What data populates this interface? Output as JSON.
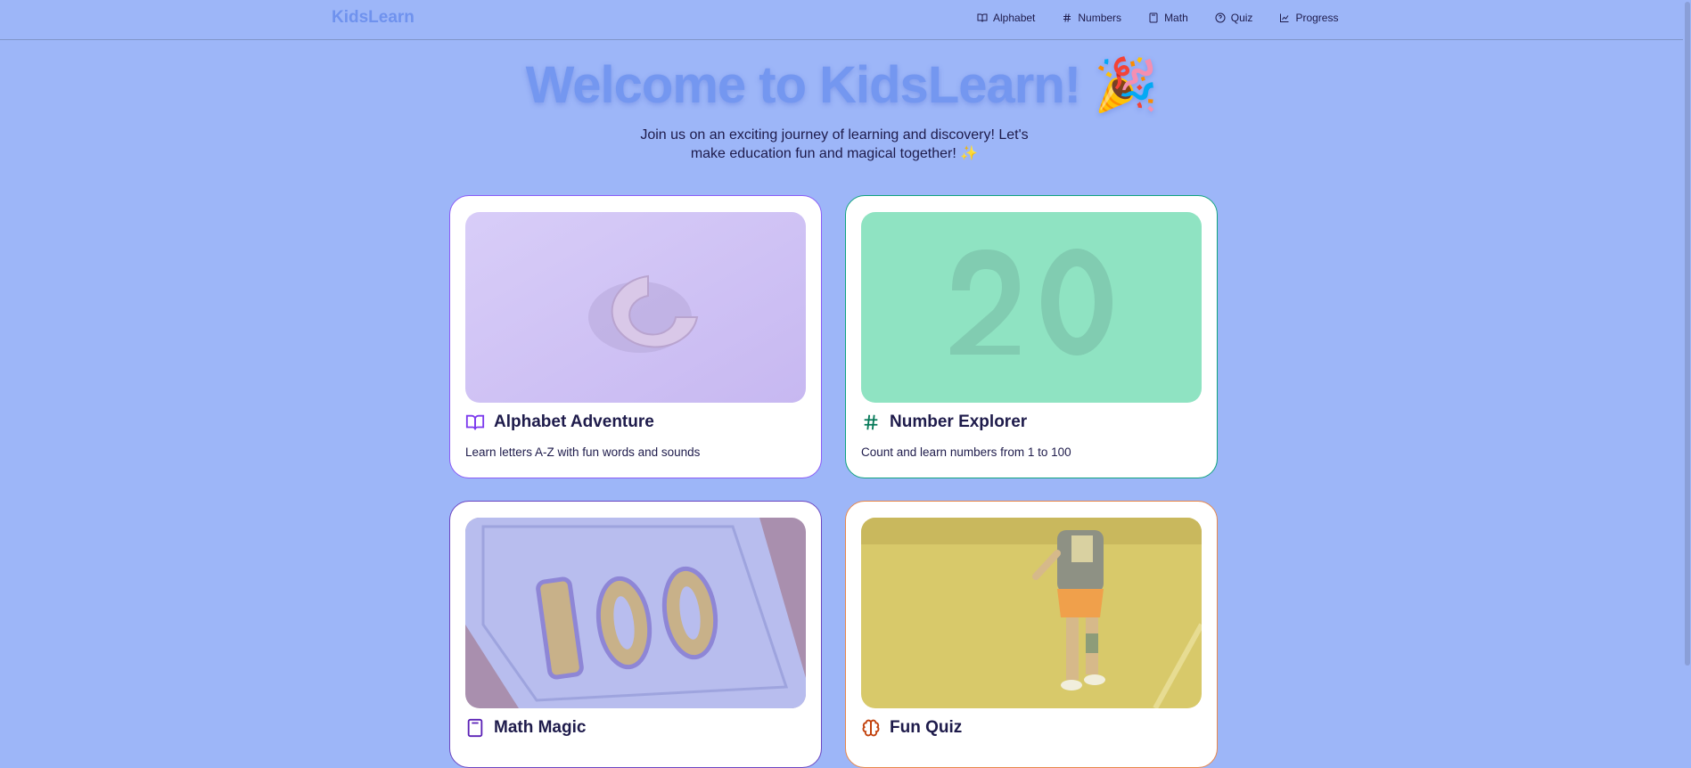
{
  "nav": {
    "brand": "KidsLearn",
    "links": [
      {
        "label": "Alphabet",
        "icon": "book-icon"
      },
      {
        "label": "Numbers",
        "icon": "hash-icon"
      },
      {
        "label": "Math",
        "icon": "calculator-icon"
      },
      {
        "label": "Quiz",
        "icon": "quiz-icon"
      },
      {
        "label": "Progress",
        "icon": "chart-icon"
      }
    ]
  },
  "hero": {
    "title": "Welcome to KidsLearn! 🎉",
    "subtitle": "Join us on an exciting journey of learning and discovery! Let's make education fun and magical together! ✨"
  },
  "cards": [
    {
      "title": "Alphabet Adventure",
      "description": "Learn letters A-Z with fun words and sounds",
      "icon": "book-icon",
      "accent": "#7c3aed"
    },
    {
      "title": "Number Explorer",
      "description": "Count and learn numbers from 1 to 100",
      "icon": "hash-icon",
      "accent": "#047857"
    },
    {
      "title": "Math Magic",
      "description": "",
      "icon": "calculator-icon",
      "accent": "#5b21b6"
    },
    {
      "title": "Fun Quiz",
      "description": "",
      "icon": "brain-icon",
      "accent": "#c2410c"
    }
  ],
  "colors": {
    "background": "#9db6f8",
    "brand": "#6f92ee",
    "text": "#1e1b4b"
  }
}
